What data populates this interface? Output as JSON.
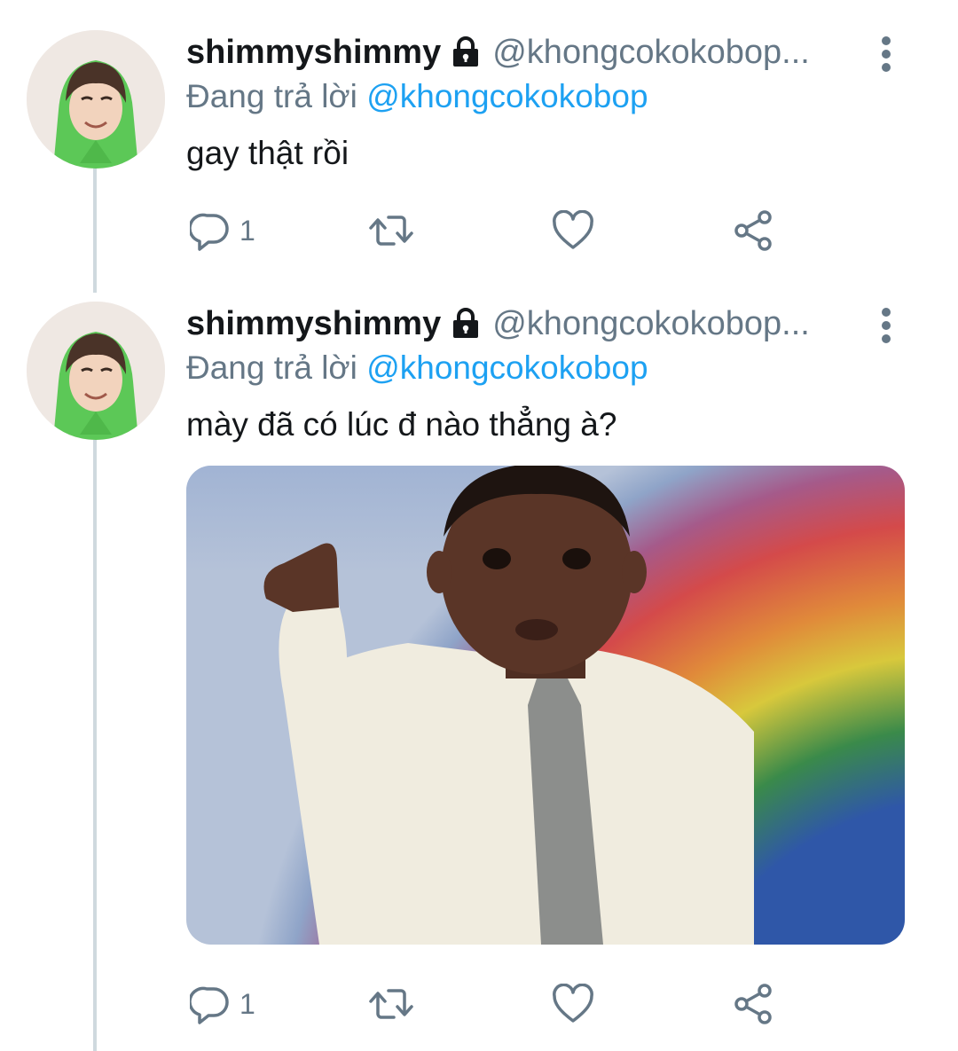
{
  "tweets": [
    {
      "display_name": "shimmyshimmy",
      "handle": "@khongcokokobop...",
      "reply_prefix": "Đang trả lời",
      "reply_mention": "@khongcokokobop",
      "text": "gay thật rồi",
      "reply_count": "1",
      "has_media": false
    },
    {
      "display_name": "shimmyshimmy",
      "handle": "@khongcokokobop...",
      "reply_prefix": "Đang trả lời",
      "reply_mention": "@khongcokokobop",
      "text": "mày đã có lúc đ nào thẳng à?",
      "reply_count": "1",
      "has_media": true
    }
  ],
  "icons": {
    "protected": "lock-icon",
    "more": "more-vertical-icon",
    "reply": "reply-icon",
    "retweet": "retweet-icon",
    "like": "heart-icon",
    "share": "share-icon"
  },
  "colors": {
    "primary_text": "#14171a",
    "secondary_text": "#657786",
    "mention": "#1da1f2",
    "thread_line": "#cfd9de"
  }
}
